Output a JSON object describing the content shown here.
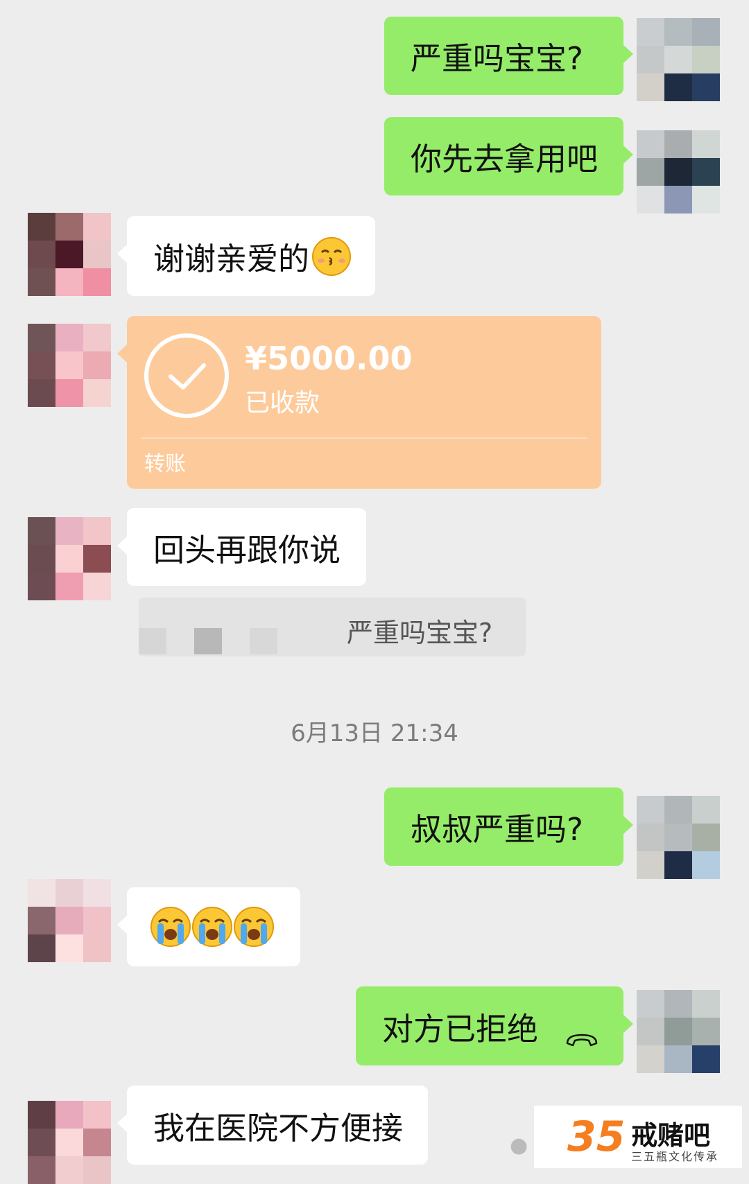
{
  "messages": {
    "m1": "严重吗宝宝?",
    "m2": "你先去拿用吧",
    "m3": "谢谢亲爱的",
    "m3_emoji": "kiss-face-emoji",
    "m5": "回头再跟你说",
    "m6": "叔叔严重吗?",
    "m7_emoji": "loudly-crying-face-emoji",
    "m8": "对方已拒绝",
    "m9": "我在医院不方便接"
  },
  "transfer": {
    "amount": "¥5000.00",
    "status": "已收款",
    "label": "转账",
    "icon": "check-circle-icon"
  },
  "quote": {
    "text": "严重吗宝宝?"
  },
  "timestamp": "6月13日 21:34",
  "watermark": {
    "logo": "35",
    "name": "戒赌吧",
    "subtitle": "三五瓶文化传承"
  },
  "colors": {
    "background": "#ededed",
    "my_bubble": "#95ec69",
    "other_bubble": "#ffffff",
    "transfer_card": "#fdcb9b",
    "brand_orange": "#f57e20"
  }
}
